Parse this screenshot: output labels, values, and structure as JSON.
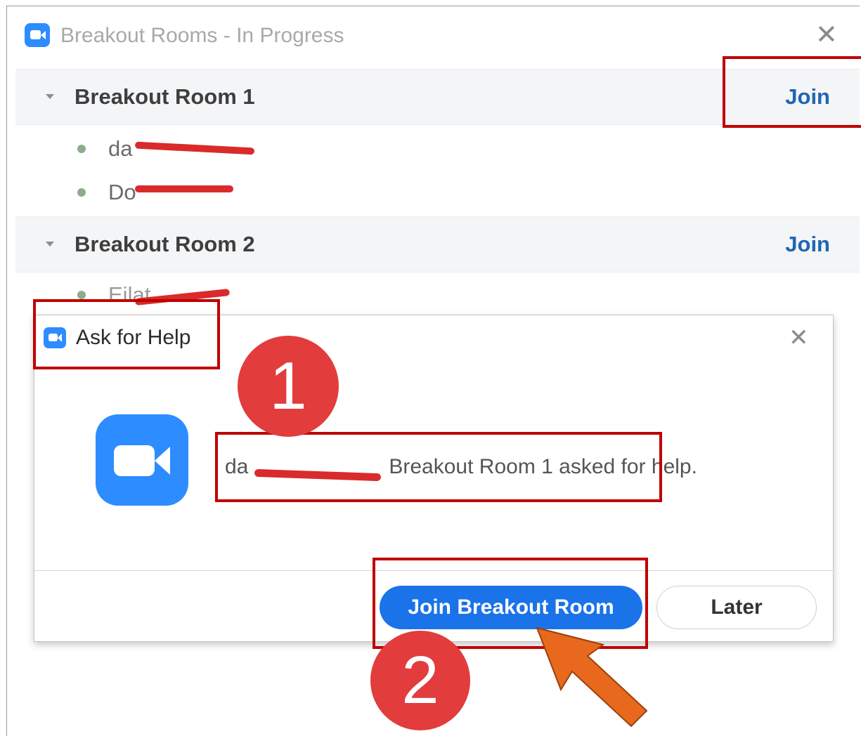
{
  "window": {
    "title": "Breakout Rooms - In Progress",
    "close_symbol": "✕"
  },
  "rooms": [
    {
      "name": "Breakout Room 1",
      "join_label": "Join",
      "participants": [
        "da",
        "Do"
      ]
    },
    {
      "name": "Breakout Room 2",
      "join_label": "Join",
      "participants": [
        "Eilat"
      ]
    }
  ],
  "dialog": {
    "title": "Ask for Help",
    "close_symbol": "✕",
    "message_prefix": "da",
    "message": "Breakout Room 1 asked for help.",
    "primary_button": "Join Breakout Room",
    "secondary_button": "Later"
  },
  "annotations": {
    "badge_1": "1",
    "badge_2": "2",
    "highlight_color": "#c00000",
    "badge_color": "#e23c3c",
    "arrow_color": "#e8691e"
  },
  "colors": {
    "accent": "#2d8cff",
    "link": "#1f66b3",
    "button": "#1a73e8"
  }
}
